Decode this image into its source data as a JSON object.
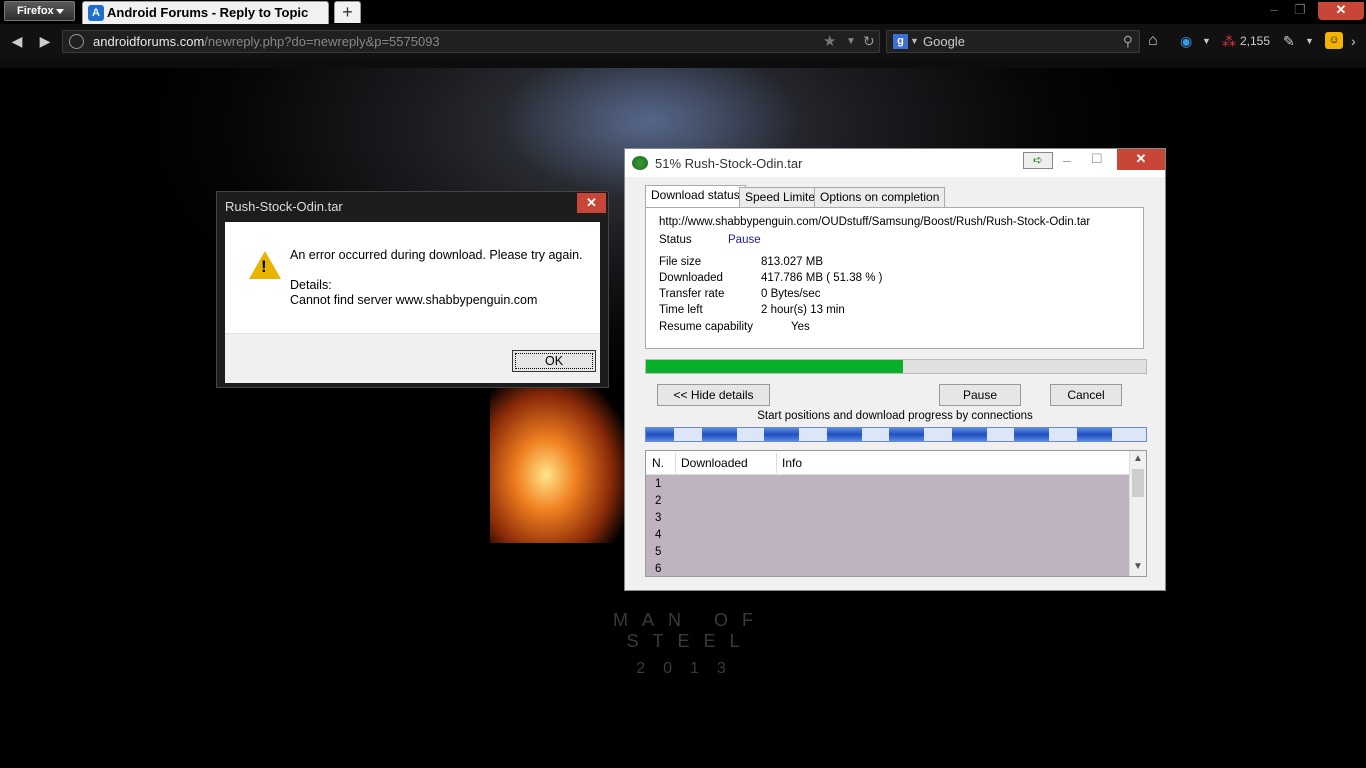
{
  "browser": {
    "menu_button": "Firefox",
    "tab_title": "Android Forums - Reply to Topic",
    "new_tab": "+",
    "url_host": "androidforums.com",
    "url_path": "/newreply.php?do=newreply&p=5575093",
    "search_placeholder": "Google",
    "counter": "2,155"
  },
  "page": {
    "poster_title": "MAN OF STEEL",
    "poster_year": "2013"
  },
  "error_dialog": {
    "title": "Rush-Stock-Odin.tar",
    "close": "✕",
    "message": "An error occurred during download. Please try again.",
    "details_label": "Details:",
    "details_text": "Cannot find server www.shabbypenguin.com",
    "ok": "OK"
  },
  "idm": {
    "title": "51% Rush-Stock-Odin.tar",
    "close": "✕",
    "tabs": [
      "Download status",
      "Speed Limiter",
      "Options on completion"
    ],
    "url": "http://www.shabbypenguin.com/OUDstuff/Samsung/Boost/Rush/Rush-Stock-Odin.tar",
    "status_label": "Status",
    "status_value": "Pause",
    "fields": [
      {
        "label": "File size",
        "value": "813.027  MB"
      },
      {
        "label": "Downloaded",
        "value": "417.786  MB  ( 51.38 % )"
      },
      {
        "label": "Transfer rate",
        "value": "0  Bytes/sec"
      },
      {
        "label": "Time left",
        "value": "2 hour(s) 13 min"
      },
      {
        "label": "Resume capability",
        "value": "Yes"
      }
    ],
    "progress_fraction": 0.5138,
    "buttons": {
      "hide": "<< Hide details",
      "pause": "Pause",
      "cancel": "Cancel"
    },
    "connections_label": "Start positions and download progress by connections",
    "table_headers": [
      "N.",
      "Downloaded",
      "Info"
    ],
    "rows": [
      "1",
      "2",
      "3",
      "4",
      "5",
      "6"
    ]
  },
  "colors": {
    "progress": "#0ab02a",
    "close_red": "#c74637"
  }
}
